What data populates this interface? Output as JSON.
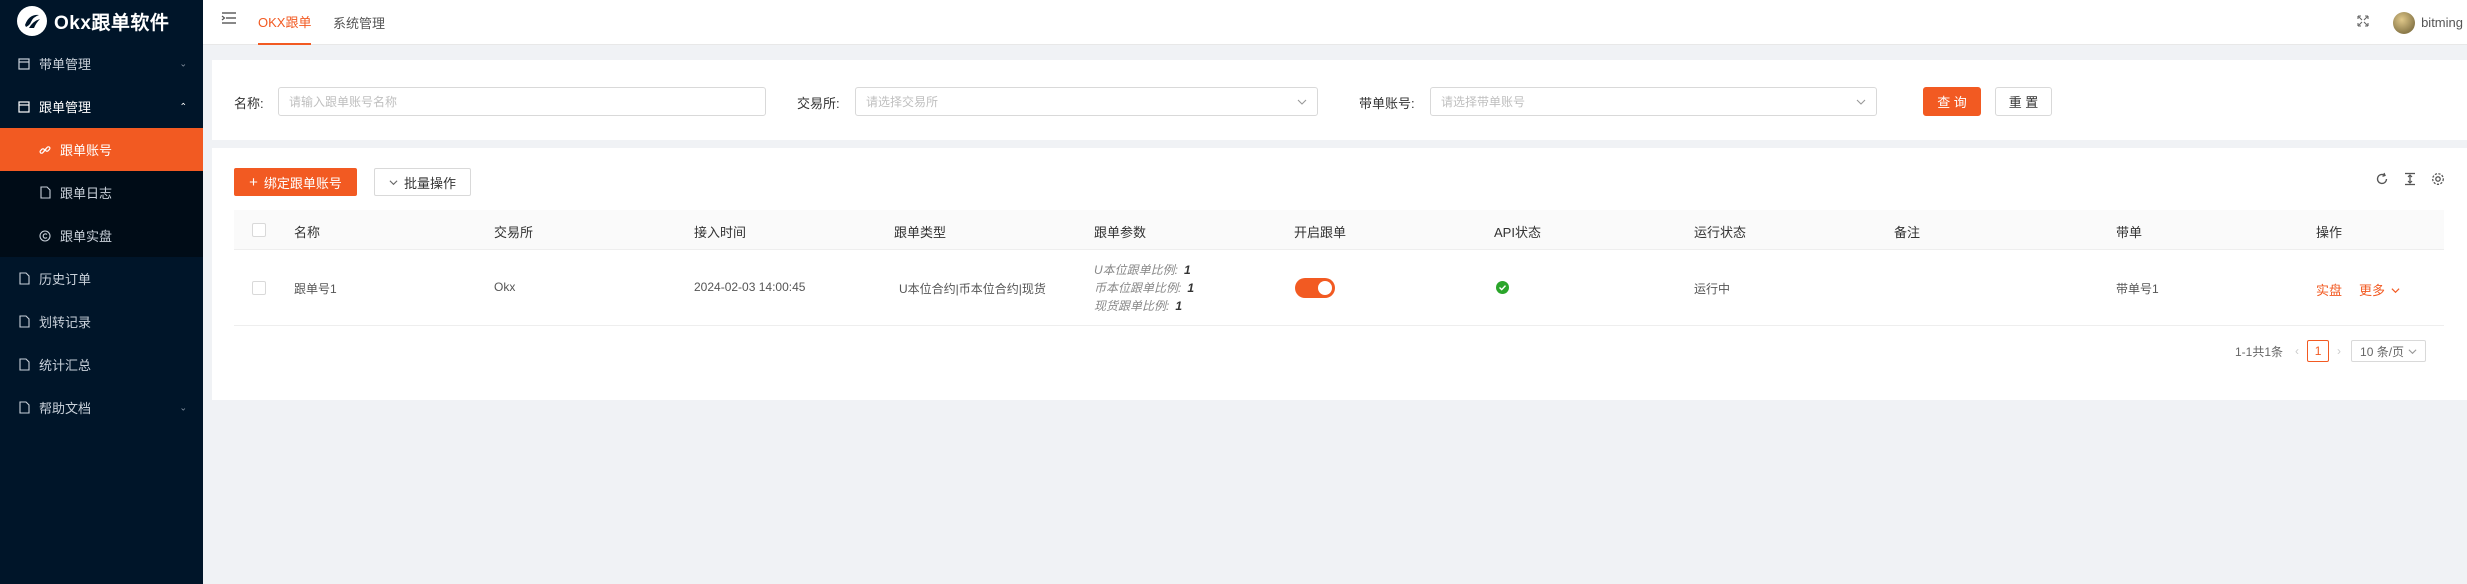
{
  "app": {
    "title": "Okx跟单软件"
  },
  "sidebar": {
    "items": [
      {
        "label": "带单管理"
      },
      {
        "label": "跟单管理"
      },
      {
        "label": "跟单账号"
      },
      {
        "label": "跟单日志"
      },
      {
        "label": "跟单实盘"
      },
      {
        "label": "历史订单"
      },
      {
        "label": "划转记录"
      },
      {
        "label": "统计汇总"
      },
      {
        "label": "帮助文档"
      }
    ]
  },
  "header": {
    "tabs": [
      {
        "label": "OKX跟单"
      },
      {
        "label": "系统管理"
      }
    ],
    "username": "bitming"
  },
  "search": {
    "name_label": "名称:",
    "name_placeholder": "请输入跟单账号名称",
    "exchange_label": "交易所:",
    "exchange_placeholder": "请选择交易所",
    "leader_label": "带单账号:",
    "leader_placeholder": "请选择带单账号",
    "query_button": "查 询",
    "reset_button": "重 置"
  },
  "toolbar": {
    "bind_button": "绑定跟单账号",
    "batch_button": "批量操作"
  },
  "table": {
    "columns": [
      "名称",
      "交易所",
      "接入时间",
      "跟单类型",
      "跟单参数",
      "开启跟单",
      "API状态",
      "运行状态",
      "备注",
      "带单",
      "操作"
    ],
    "rows": [
      {
        "name": "跟单号1",
        "exchange": "Okx",
        "time": "2024-02-03 14:00:45",
        "type": "U本位合约|币本位合约|现货",
        "params": [
          {
            "label": "U本位跟单比例:",
            "value": "1"
          },
          {
            "label": "币本位跟单比例:",
            "value": "1"
          },
          {
            "label": "现货跟单比例:",
            "value": "1"
          }
        ],
        "follow_enabled": true,
        "api_status_color": "#2aa52a",
        "run_status": "运行中",
        "remark": "",
        "leader": "带单号1",
        "action_live": "实盘",
        "action_more": "更多"
      }
    ]
  },
  "pagination": {
    "summary": "1-1共1条",
    "current_page": "1",
    "page_size": "10 条/页"
  },
  "colors": {
    "accent": "#f25a22",
    "sidebar_bg": "#001529"
  }
}
